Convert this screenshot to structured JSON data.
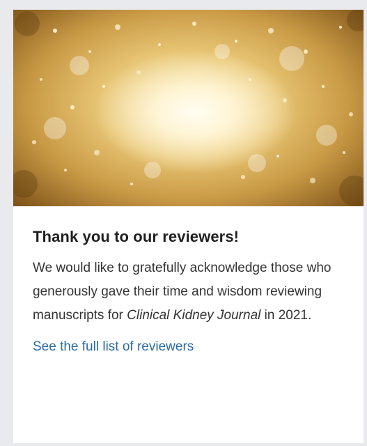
{
  "card": {
    "title": "Thank you to our reviewers!",
    "body": {
      "before": "We would like to gratefully acknowledge those who generously gave their time and wisdom reviewing manuscripts for ",
      "journal": "Clinical Kidney Journal",
      "after": " in 2021."
    },
    "link_label": "See the full list of reviewers"
  },
  "colors": {
    "title": "#1f1f1f",
    "text": "#333333",
    "link": "#2a6ba5",
    "page_background": "#e8eaed",
    "card_background": "#ffffff"
  }
}
